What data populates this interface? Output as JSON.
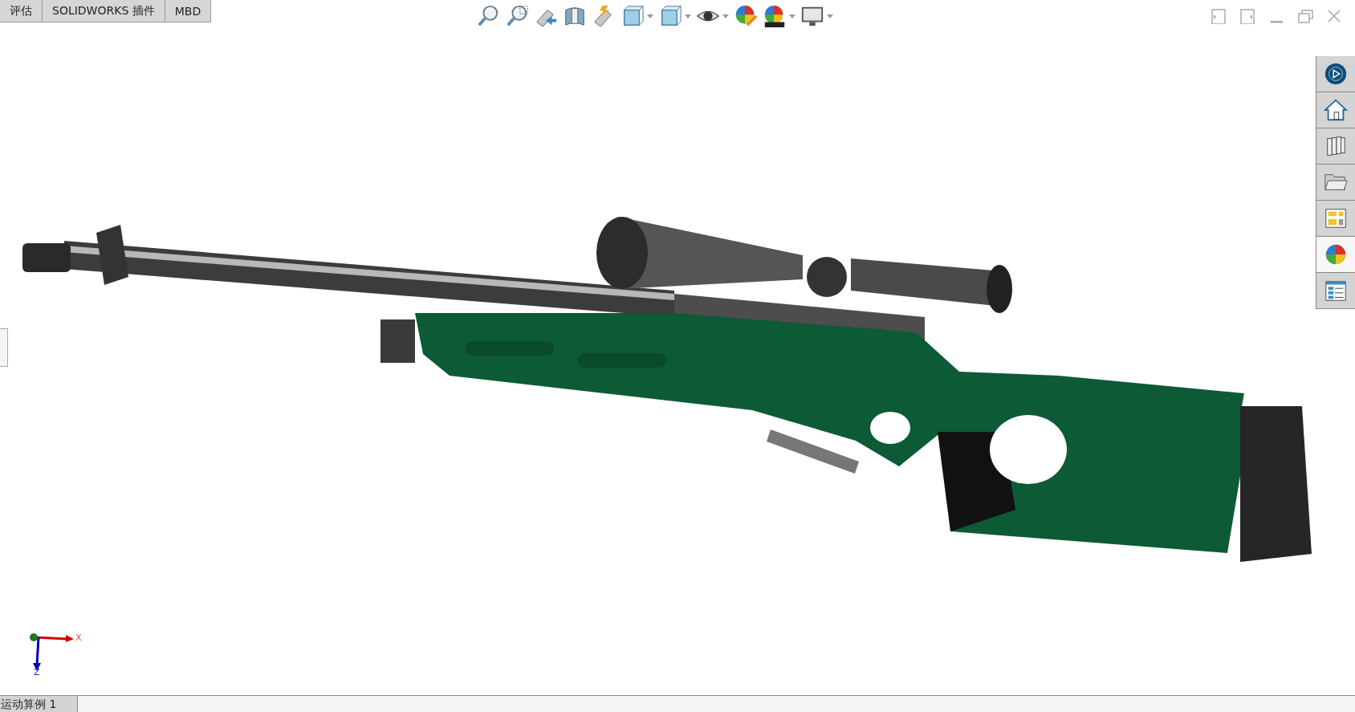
{
  "command_tabs": [
    {
      "label": "评估"
    },
    {
      "label": "SOLIDWORKS 插件"
    },
    {
      "label": "MBD"
    }
  ],
  "view_toolbar": [
    {
      "kind": "zoom-fit",
      "dropdown": false
    },
    {
      "kind": "zoom-area",
      "dropdown": false
    },
    {
      "kind": "previous-view",
      "dropdown": false
    },
    {
      "kind": "section",
      "dropdown": false
    },
    {
      "kind": "annotation",
      "dropdown": false
    },
    {
      "kind": "orientation",
      "dropdown": true
    },
    {
      "kind": "display-style",
      "dropdown": true
    },
    {
      "kind": "hide-show",
      "dropdown": true
    },
    {
      "kind": "edit-appearance",
      "dropdown": false
    },
    {
      "kind": "scene",
      "dropdown": true
    },
    {
      "kind": "display",
      "dropdown": true
    }
  ],
  "task_pane": [
    {
      "kind": "community",
      "selected": false
    },
    {
      "kind": "home",
      "selected": false
    },
    {
      "kind": "library",
      "selected": false
    },
    {
      "kind": "folder",
      "selected": false
    },
    {
      "kind": "palette",
      "selected": false
    },
    {
      "kind": "appearance",
      "selected": true
    },
    {
      "kind": "properties",
      "selected": false
    }
  ],
  "graphics": {
    "kind": "product"
  },
  "triad": {
    "x_label": "X",
    "z_label": "Z"
  },
  "bottom_tabs": [
    {
      "label": "运动算例 1",
      "selected": true
    }
  ]
}
